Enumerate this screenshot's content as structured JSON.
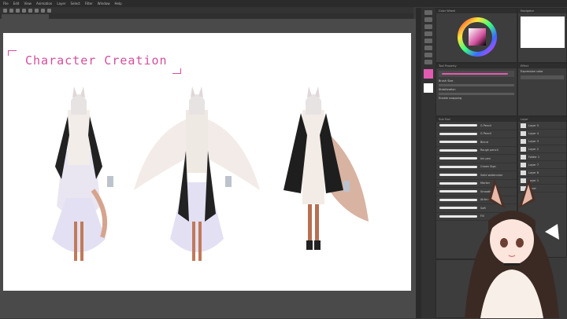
{
  "menu": [
    "File",
    "Edit",
    "View",
    "Animation",
    "Layer",
    "Select",
    "Filter",
    "Window",
    "Help"
  ],
  "canvas": {
    "title": "Character Creation"
  },
  "panels": {
    "color_wheel": "Color Wheel",
    "navigator": "Navigator",
    "tool_property": "Tool Property",
    "sub_tool": "Sub Tool",
    "layer": "Layer",
    "brush_size_label": "Brush Size",
    "stabilization_label": "Stabilization",
    "enable_snapping_label": "Enable snapping",
    "effect_label": "Effect",
    "expression_color_label": "Expression color"
  },
  "brushes": [
    "G Pencil",
    "G Pencil",
    "Blend",
    "Rough pencil",
    "Ink pen",
    "Crown Sign",
    "Solid watercolor",
    "Marker",
    "Smooth",
    "Airbrush",
    "Soft",
    "Fill"
  ],
  "layers": [
    "Layer 5",
    "Layer 4",
    "Layer 3",
    "Layer 2",
    "Folder 1",
    "Layer 7",
    "Layer 6",
    "Layer 1",
    "Paper"
  ],
  "colors": {
    "accent": "#d14f9c",
    "canvas": "#ffffff",
    "ui_bg": "#3a3a3a"
  }
}
